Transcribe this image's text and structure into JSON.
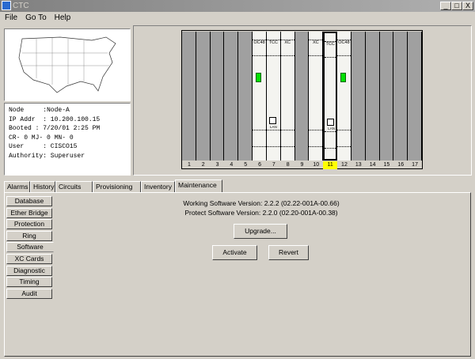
{
  "window": {
    "title": "CTC",
    "min": "_",
    "max": "□",
    "close": "X"
  },
  "menu": [
    "File",
    "Go To",
    "Help"
  ],
  "node_info": [
    "Node     :Node-A",
    "IP Addr  : 10.200.100.15",
    "Booted : 7/20/01 2:25 PM",
    "CR- 0 MJ- 0 MN- 0",
    "User     : CISCO15",
    "Authority: Superuser"
  ],
  "shelf": {
    "slots": [
      {
        "n": "1"
      },
      {
        "n": "2"
      },
      {
        "n": "3"
      },
      {
        "n": "4"
      },
      {
        "n": "5"
      },
      {
        "n": "6",
        "card": "OC48",
        "led": true
      },
      {
        "n": "7",
        "card": "TCC",
        "lan": "LAN"
      },
      {
        "n": "8",
        "card": "XC"
      },
      {
        "n": "9"
      },
      {
        "n": "10",
        "card": "XC"
      },
      {
        "n": "11",
        "card": "TCC",
        "lan": "LAN",
        "selected": true
      },
      {
        "n": "12",
        "card": "OC48",
        "led": true
      },
      {
        "n": "13"
      },
      {
        "n": "14"
      },
      {
        "n": "15"
      },
      {
        "n": "16"
      },
      {
        "n": "17"
      }
    ],
    "selected_color": "#ffff00",
    "led_color": "#00e000"
  },
  "tabs": [
    "Alarms",
    "History",
    "Circuits",
    "Provisioning",
    "Inventory",
    "Maintenance"
  ],
  "active_tab": "Maintenance",
  "subtabs": [
    "Database",
    "Ether Bridge",
    "Protection",
    "Ring",
    "Software",
    "XC Cards",
    "Diagnostic",
    "Timing",
    "Audit"
  ],
  "active_subtab": "Software",
  "software": {
    "working": "Working Software Version: 2.2.2 (02.22-001A-00.66)",
    "protect": "Protect Software Version: 2.2.0 (02.20-001A-00.38)",
    "upgrade": "Upgrade...",
    "activate": "Activate",
    "revert": "Revert"
  }
}
